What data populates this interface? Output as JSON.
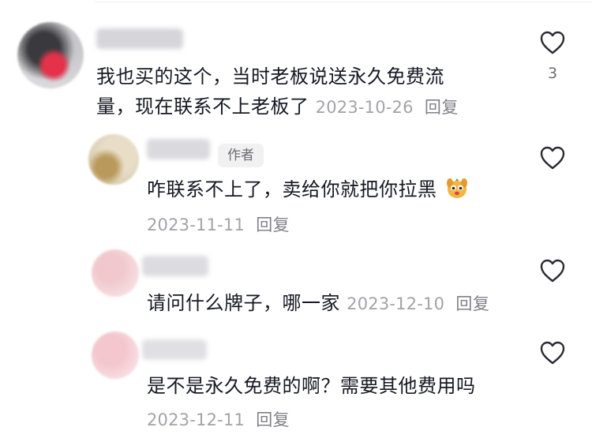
{
  "comments": [
    {
      "text_line1": "我也买的这个，当时老板说送永久免费流",
      "text_line2": "量，现在联系不上老板了",
      "date": "2023-10-26",
      "reply_label": "回复",
      "like_count": "3"
    },
    {
      "badge": "作者",
      "text": "咋联系不上了，卖给你就把你拉黑",
      "date": "2023-11-11",
      "reply_label": "回复",
      "emoji": "dog-face-emoji"
    },
    {
      "text": "请问什么牌子，哪一家",
      "date": "2023-12-10",
      "reply_label": "回复"
    },
    {
      "text": "是不是永久免费的啊？需要其他费用吗",
      "date": "2023-12-11",
      "reply_label": "回复"
    }
  ],
  "icons": {
    "like": "heart-outline-icon"
  },
  "colors": {
    "text": "#161823",
    "meta": "#a3a3a8",
    "badge_bg": "#f1f1f2"
  }
}
